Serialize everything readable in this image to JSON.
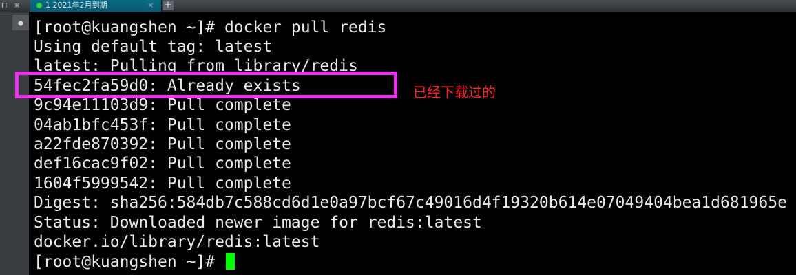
{
  "tabbar": {
    "pin_icon": "pin-icon",
    "close_icon": "close-icon",
    "tab_title": "1 2021年2月到期",
    "tab_close": "×",
    "new_tab": "+"
  },
  "sidebar": {
    "search_icon": "search-icon"
  },
  "terminal": {
    "lines": [
      "[root@kuangshen ~]# docker pull redis",
      "Using default tag: latest",
      "latest: Pulling from library/redis",
      "54fec2fa59d0: Already exists",
      "9c94e11103d9: Pull complete",
      "04ab1bfc453f: Pull complete",
      "a22fde870392: Pull complete",
      "def16cac9f02: Pull complete",
      "1604f5999542: Pull complete",
      "Digest: sha256:584db7c588cd6d1e0a97bcf67c49016d4f19320b614e07049404bea1d681965e",
      "Status: Downloaded newer image for redis:latest",
      "docker.io/library/redis:latest",
      "[root@kuangshen ~]# "
    ],
    "cursor_color": "#00ff00"
  },
  "annotation": {
    "text": "已经下载过的",
    "text_color": "#ff2a2a",
    "box_color": "#ee33ee"
  }
}
